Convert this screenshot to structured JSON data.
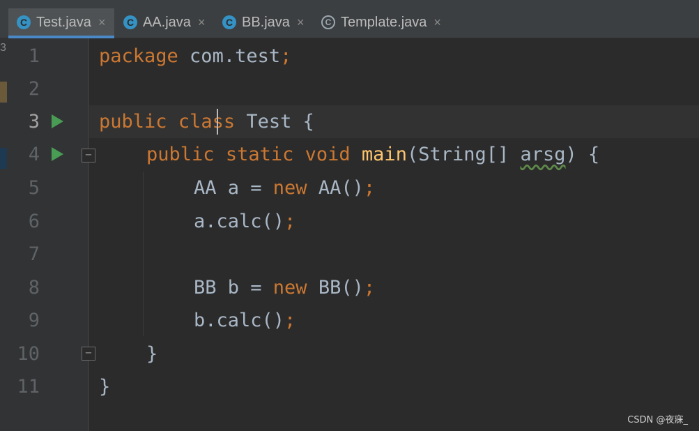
{
  "tabs": [
    {
      "label": "Test.java",
      "icon": "class-icon",
      "active": true
    },
    {
      "label": "AA.java",
      "icon": "class-icon",
      "active": false
    },
    {
      "label": "BB.java",
      "icon": "class-icon",
      "active": false
    },
    {
      "label": "Template.java",
      "icon": "abstract-class-icon",
      "active": false
    }
  ],
  "tab_close_glyph": "×",
  "class_icon_letter": "C",
  "left_strip_number": "3",
  "line_numbers": [
    "1",
    "2",
    "3",
    "4",
    "5",
    "6",
    "7",
    "8",
    "9",
    "10",
    "11"
  ],
  "code": {
    "l1": {
      "kw": "package",
      "rest": " com.test",
      "semi": ";"
    },
    "l3": {
      "kw1": "public",
      "kw2": "class",
      "rest": " Test {"
    },
    "l4": {
      "kw1": "public",
      "kw2": "static",
      "kw3": "void",
      "fn": "main",
      "params": "(String[] ",
      "warn_param": "arsg",
      "end": ") {"
    },
    "l5": {
      "a": "AA a = ",
      "kw": "new",
      "b": " AA()",
      "semi": ";"
    },
    "l6": {
      "a": "a.calc()",
      "semi": ";"
    },
    "l8": {
      "a": "BB b = ",
      "kw": "new",
      "b": " BB()",
      "semi": ";"
    },
    "l9": {
      "a": "b.calc()",
      "semi": ";"
    },
    "l10": {
      "a": "}"
    },
    "l11": {
      "a": "}"
    }
  },
  "fold_glyph": "−",
  "watermark": "CSDN @夜寐_",
  "colors": {
    "keyword": "#cc7832",
    "function": "#ffc66d",
    "text": "#a9b7c6",
    "run": "#499c54",
    "background": "#2b2b2b"
  }
}
